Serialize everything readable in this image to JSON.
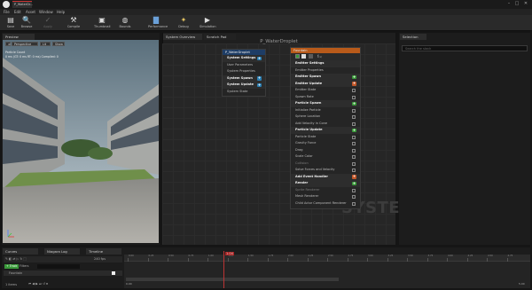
{
  "app": {
    "tab_title": "P_WaterDr...",
    "minimize": "–",
    "maximize": "□",
    "close": "✕"
  },
  "menu": [
    "File",
    "Edit",
    "Asset",
    "Window",
    "Help"
  ],
  "toolbar": [
    {
      "label": "Save",
      "icon": "save-icon",
      "glyph": "▤"
    },
    {
      "label": "Browse",
      "icon": "browse-icon",
      "glyph": "🔍"
    },
    {
      "label": "Apply",
      "icon": "apply-icon",
      "glyph": "✓"
    },
    {
      "label": "Compile",
      "icon": "compile-icon",
      "glyph": "⚒"
    },
    {
      "label": "Thumbnail",
      "icon": "thumbnail-icon",
      "glyph": "▣"
    },
    {
      "label": "Bounds",
      "icon": "bounds-icon",
      "glyph": "◍"
    },
    {
      "label": "Performance",
      "icon": "performance-icon",
      "glyph": "▇"
    },
    {
      "label": "Debug",
      "icon": "debug-icon",
      "glyph": "✦"
    },
    {
      "label": "Simulation",
      "icon": "simulation-icon",
      "glyph": "▶"
    }
  ],
  "preview": {
    "tab": "Preview",
    "perspective": "Perspective",
    "lit": "Lit",
    "show": "Show",
    "overlay_line1": "Particle Count",
    "overlay_line2": "0 ms (GT: 0 ms RT: 0 ms) Compiled: 0"
  },
  "graph": {
    "tabs": [
      "System Overview",
      "Scratch Pad"
    ],
    "title": "P_WaterDroplet",
    "watermark": "SYSTEM"
  },
  "system_node": {
    "title": "P_WaterDroplet",
    "rows": [
      {
        "label": "System Settings",
        "section": true,
        "plus": true
      },
      {
        "label": "User Parameters",
        "section": false
      },
      {
        "label": "System Properties",
        "section": false
      },
      {
        "label": "System Spawn",
        "section": true,
        "plus": true
      },
      {
        "label": "System Update",
        "section": true,
        "plus": true
      },
      {
        "label": "System State",
        "section": false
      }
    ]
  },
  "emitter_node": {
    "title": "Fountain",
    "rows": [
      {
        "label": "Emitter Settings",
        "section": true
      },
      {
        "label": "Emitter Properties",
        "section": false
      },
      {
        "label": "Emitter Spawn",
        "section": true,
        "plus": true
      },
      {
        "label": "Emitter Update",
        "section": true,
        "plus": true
      },
      {
        "label": "Emitter State",
        "section": false,
        "check": true
      },
      {
        "label": "Spawn Rate",
        "section": false,
        "check": true
      },
      {
        "label": "Particle Spawn",
        "section": true,
        "plus": true
      },
      {
        "label": "Initialize Particle",
        "section": false,
        "check": true
      },
      {
        "label": "Sphere Location",
        "section": false,
        "check": true
      },
      {
        "label": "Add Velocity in Cone",
        "section": false,
        "check": true
      },
      {
        "label": "Particle Update",
        "section": true,
        "plus": true
      },
      {
        "label": "Particle State",
        "section": false,
        "check": true
      },
      {
        "label": "Gravity Force",
        "section": false,
        "check": true
      },
      {
        "label": "Drag",
        "section": false,
        "check": true
      },
      {
        "label": "Scale Color",
        "section": false,
        "check": true
      },
      {
        "label": "Collision",
        "section": false,
        "dim": true,
        "check": true
      },
      {
        "label": "Solve Forces and Velocity",
        "section": false,
        "check": true
      },
      {
        "label": "Add Event Handler",
        "section": true,
        "plus": true
      },
      {
        "label": "Render",
        "section": true,
        "plus": true
      },
      {
        "label": "Sprite Renderer",
        "section": false,
        "dim": true,
        "check": true
      },
      {
        "label": "Mesh Renderer",
        "section": false,
        "check": true
      },
      {
        "label": "Child Actor Component Renderer",
        "section": false,
        "check": true
      }
    ]
  },
  "selection": {
    "tab": "Selection",
    "search_placeholder": "Search the stack"
  },
  "bottom": {
    "tabs": [
      "Curves",
      "Niagara Log",
      "Timeline"
    ],
    "filters_label": "Filters",
    "add_track": "+ Track",
    "fps": "240 fps",
    "track_name": "Fountain",
    "items_count": "1 items",
    "playhead": "1.04",
    "range_start": "0.00",
    "range_end": "5.00",
    "ticks": [
      "0.00",
      "0.25",
      "0.50",
      "0.75",
      "1.00",
      "1.25",
      "1.50",
      "1.75",
      "2.00",
      "2.25",
      "2.50",
      "2.75",
      "3.00",
      "3.25",
      "3.50",
      "3.75",
      "4.00",
      "4.25",
      "4.50",
      "4.75"
    ]
  },
  "colors": {
    "accent_green": "#3a9a3a",
    "node_header_blue": "#1e3d66",
    "node_header_orange": "#b85a1a",
    "playhead_red": "#b33333"
  }
}
